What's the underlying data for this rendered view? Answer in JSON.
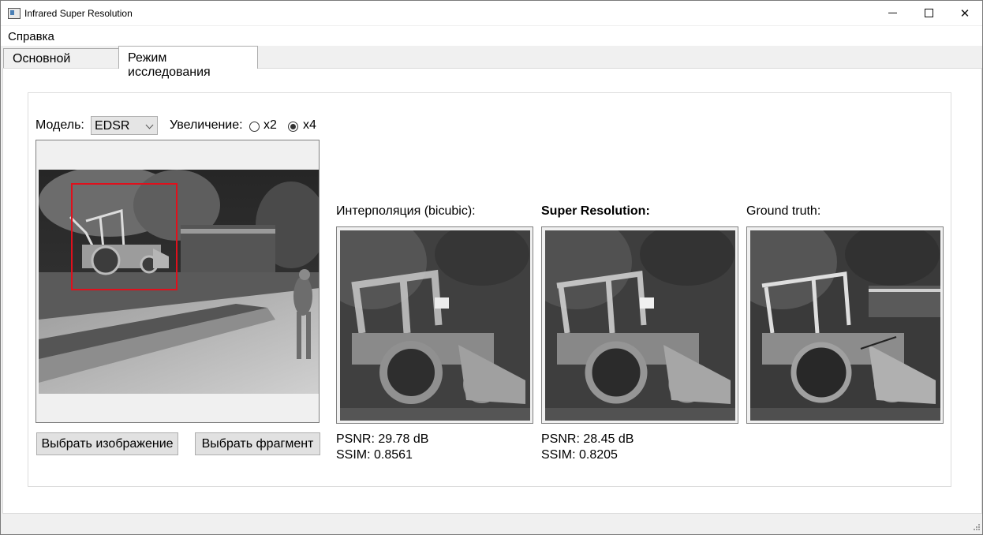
{
  "window": {
    "title": "Infrared Super Resolution"
  },
  "menu": {
    "items": [
      "Справка"
    ]
  },
  "tabs": [
    {
      "label": "Основной режим",
      "active": false
    },
    {
      "label": "Режим исследования",
      "active": true
    }
  ],
  "controls": {
    "model_label": "Модель:",
    "model_value": "EDSR",
    "zoom_label": "Увеличение:",
    "zoom_options": [
      {
        "label": "x2",
        "checked": false
      },
      {
        "label": "x4",
        "checked": true
      }
    ]
  },
  "buttons": {
    "select_image": "Выбрать изображение",
    "select_fragment": "Выбрать фрагмент"
  },
  "panels": [
    {
      "title": "Интерполяция (bicubic):",
      "bold": false,
      "psnr": "PSNR: 29.78 dB",
      "ssim": "SSIM: 0.8561"
    },
    {
      "title": "Super Resolution:",
      "bold": true,
      "psnr": "PSNR: 28.45 dB",
      "ssim": "SSIM: 0.8205"
    },
    {
      "title": "Ground truth:",
      "bold": false
    }
  ],
  "colors": {
    "selection_rect": "#e0101c",
    "window_bg": "#f0f0f0"
  }
}
